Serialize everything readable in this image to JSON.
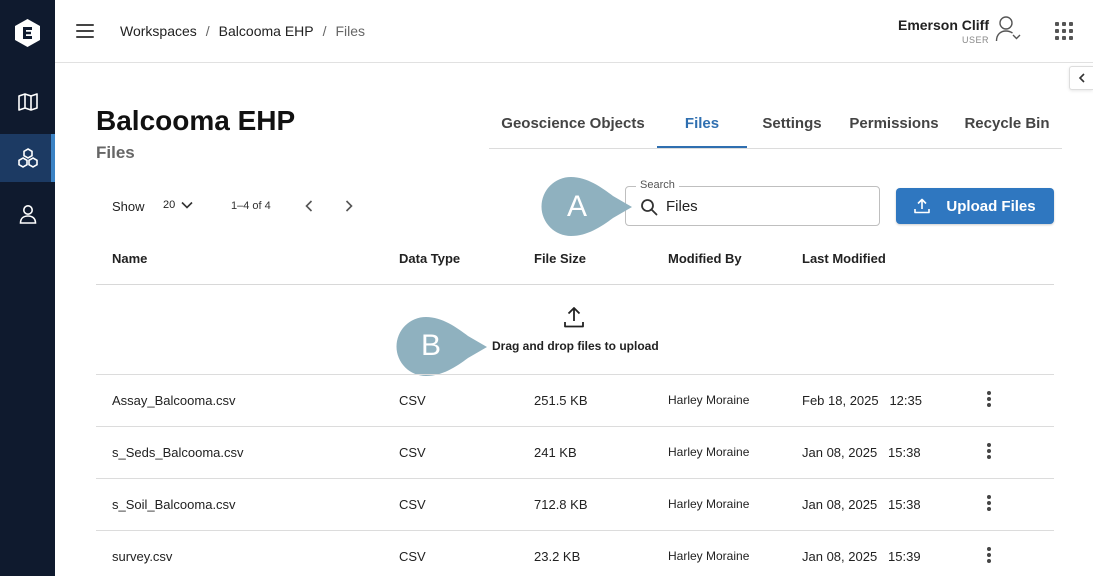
{
  "breadcrumb": [
    "Workspaces",
    "Balcooma EHP",
    "Files"
  ],
  "breadcrumb_sep": "/",
  "user": {
    "name": "Emerson Cliff",
    "role": "USER"
  },
  "page": {
    "title": "Balcooma EHP",
    "subtitle": "Files"
  },
  "tabs": [
    {
      "label": "Geoscience Objects",
      "active": false
    },
    {
      "label": "Files",
      "active": true
    },
    {
      "label": "Settings",
      "active": false
    },
    {
      "label": "Permissions",
      "active": false
    },
    {
      "label": "Recycle Bin",
      "active": false
    }
  ],
  "pagination": {
    "show_label": "Show",
    "per_page": "20",
    "range": "1–4 of 4"
  },
  "search": {
    "label": "Search",
    "value": "Files"
  },
  "upload_button": "Upload Files",
  "callouts": {
    "a": "A",
    "b": "B"
  },
  "table": {
    "headers": [
      "Name",
      "Data Type",
      "File Size",
      "Modified By",
      "Last Modified"
    ],
    "dropzone": "Drag and drop files to upload",
    "rows": [
      {
        "name": "Assay_Balcooma.csv",
        "type": "CSV",
        "size": "251.5 KB",
        "by": "Harley Moraine",
        "modified": "Feb 18, 2025   12:35"
      },
      {
        "name": "s_Seds_Balcooma.csv",
        "type": "CSV",
        "size": "241 KB",
        "by": "Harley Moraine",
        "modified": "Jan 08, 2025   15:38"
      },
      {
        "name": "s_Soil_Balcooma.csv",
        "type": "CSV",
        "size": "712.8 KB",
        "by": "Harley Moraine",
        "modified": "Jan 08, 2025   15:38"
      },
      {
        "name": "survey.csv",
        "type": "CSV",
        "size": "23.2 KB",
        "by": "Harley Moraine",
        "modified": "Jan 08, 2025   15:39"
      }
    ]
  },
  "colors": {
    "rail": "#0f1a2e",
    "accent": "#2f77c0",
    "callout": "#8fb1bf"
  },
  "icons": [
    "app-logo-icon",
    "map-icon",
    "workspaces-icon",
    "user-profile-icon",
    "hamburger-icon",
    "user-icon",
    "apps-grid-icon",
    "chevron-left-icon",
    "search-icon",
    "upload-icon",
    "chevron-down-icon",
    "kebab-menu-icon"
  ]
}
